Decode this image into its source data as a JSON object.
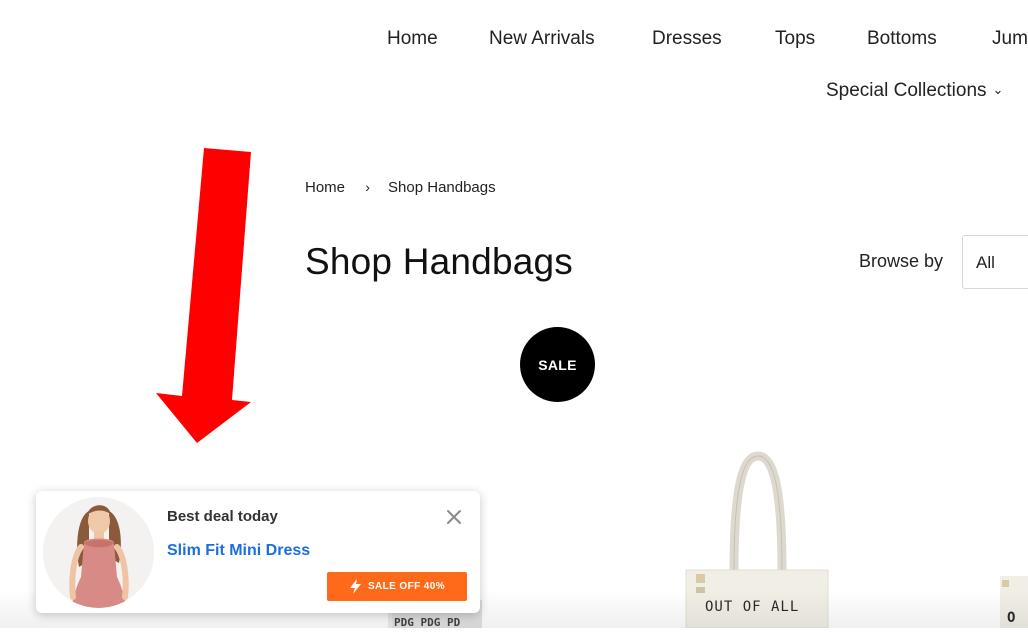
{
  "nav": {
    "items": [
      {
        "label": "Home"
      },
      {
        "label": "New Arrivals"
      },
      {
        "label": "Dresses"
      },
      {
        "label": "Tops"
      },
      {
        "label": "Bottoms"
      },
      {
        "label": "Jum"
      }
    ],
    "special_collections": "Special Collections"
  },
  "breadcrumb": {
    "home": "Home",
    "separator": "›",
    "current": "Shop Handbags"
  },
  "page": {
    "title": "Shop Handbags",
    "browse_label": "Browse by",
    "browse_value": "All",
    "sale_badge": "SALE"
  },
  "products": [
    {
      "image_text": "PDG PDG PD"
    },
    {
      "image_text": "OUT OF ALL"
    },
    {
      "image_text": "O"
    }
  ],
  "popup": {
    "heading": "Best deal today",
    "product_name": "Slim Fit Mini Dress",
    "sale_label": "SALE OFF 40%",
    "accent_color": "#ff6a1a",
    "link_color": "#1a6fd9"
  },
  "annotation": {
    "arrow_color": "#ff0000"
  }
}
